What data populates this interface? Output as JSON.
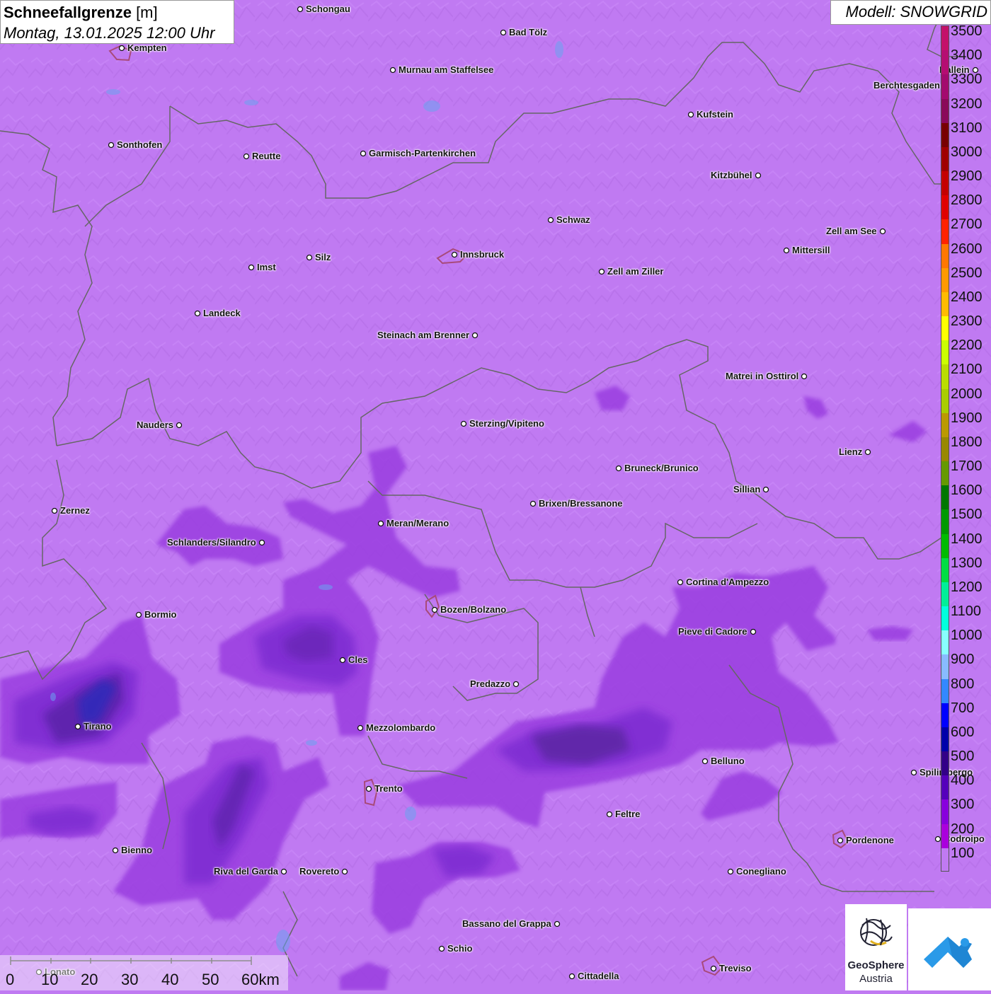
{
  "title": {
    "bold": "Schneefallgrenze",
    "unit": " [m]",
    "datetime": "Montag, 13.01.2025 12:00 Uhr"
  },
  "model_label": "Modell: SNOWGRID",
  "legend": {
    "labels": [
      "3500",
      "3400",
      "3300",
      "3200",
      "3100",
      "3000",
      "2900",
      "2800",
      "2700",
      "2600",
      "2500",
      "2400",
      "2300",
      "2200",
      "2100",
      "2000",
      "1900",
      "1800",
      "1700",
      "1600",
      "1500",
      "1400",
      "1300",
      "1200",
      "1100",
      "1000",
      "900",
      "800",
      "700",
      "600",
      "500",
      "400",
      "300",
      "200",
      "100"
    ],
    "colors": [
      "#c4106a",
      "#b50d72",
      "#a30a6e",
      "#8a0a5a",
      "#780000",
      "#a00000",
      "#c40000",
      "#e00000",
      "#ff2200",
      "#ff7700",
      "#ff9900",
      "#ffbb00",
      "#ffff00",
      "#ccff00",
      "#bbdd00",
      "#aacc00",
      "#bb9900",
      "#998800",
      "#669900",
      "#007700",
      "#009900",
      "#00bb00",
      "#00dd44",
      "#00ee99",
      "#00ffdd",
      "#88ffff",
      "#88bbff",
      "#3388ff",
      "#0000ff",
      "#0000aa",
      "#330088",
      "#5500bb",
      "#8800dd",
      "#aa00dd",
      "#c07af2"
    ]
  },
  "cities": [
    {
      "name": "Schongau"
    },
    {
      "name": "Bad Tölz"
    },
    {
      "name": "Kempten"
    },
    {
      "name": "Murnau am Staffelsee"
    },
    {
      "name": "Kufstein"
    },
    {
      "name": "Berchtesgaden"
    },
    {
      "name": "Hallein"
    },
    {
      "name": "Sonthofen"
    },
    {
      "name": "Reutte"
    },
    {
      "name": "Garmisch-Partenkirchen"
    },
    {
      "name": "Kitzbühel"
    },
    {
      "name": "Schwaz"
    },
    {
      "name": "Zell am See"
    },
    {
      "name": "Innsbruck"
    },
    {
      "name": "Mittersill"
    },
    {
      "name": "Imst"
    },
    {
      "name": "Silz"
    },
    {
      "name": "Zell am Ziller"
    },
    {
      "name": "Landeck"
    },
    {
      "name": "Steinach am Brenner"
    },
    {
      "name": "Matrei in Osttirol"
    },
    {
      "name": "Nauders"
    },
    {
      "name": "Sterzing/Vipiteno"
    },
    {
      "name": "Lienz"
    },
    {
      "name": "Bruneck/Brunico"
    },
    {
      "name": "Sillian"
    },
    {
      "name": "Zernez"
    },
    {
      "name": "Brixen/Bressanone"
    },
    {
      "name": "Meran/Merano"
    },
    {
      "name": "Schlanders/Silandro"
    },
    {
      "name": "Cortina d'Ampezzo"
    },
    {
      "name": "Bozen/Bolzano"
    },
    {
      "name": "Bormio"
    },
    {
      "name": "Pieve di Cadore"
    },
    {
      "name": "Cles"
    },
    {
      "name": "Predazzo"
    },
    {
      "name": "Tirano"
    },
    {
      "name": "Mezzolombardo"
    },
    {
      "name": "Belluno"
    },
    {
      "name": "Spilimbergo"
    },
    {
      "name": "Trento"
    },
    {
      "name": "Feltre"
    },
    {
      "name": "Pordenone"
    },
    {
      "name": "Codroipo"
    },
    {
      "name": "Bienno"
    },
    {
      "name": "Riva del Garda"
    },
    {
      "name": "Rovereto"
    },
    {
      "name": "Conegliano"
    },
    {
      "name": "Bassano del Grappa"
    },
    {
      "name": "Schio"
    },
    {
      "name": "Treviso"
    },
    {
      "name": "Cittadella"
    },
    {
      "name": "Lonato"
    }
  ],
  "scalebar": {
    "labels": [
      "0",
      "10",
      "20",
      "30",
      "40",
      "50",
      "60km"
    ]
  },
  "logos": {
    "geosphere": "GeoSphere",
    "austria": "Austria"
  }
}
